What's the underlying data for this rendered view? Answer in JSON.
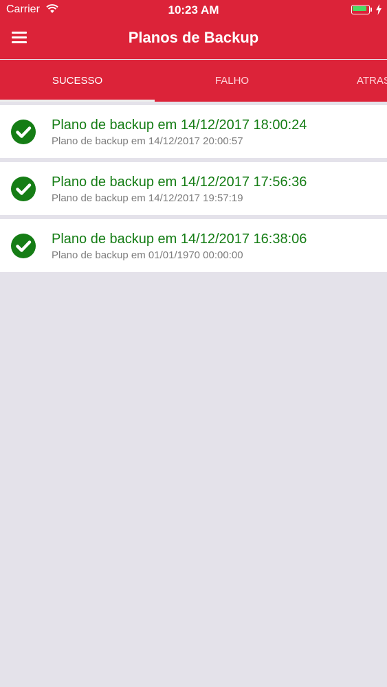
{
  "status_bar": {
    "carrier": "Carrier",
    "time": "10:23 AM",
    "battery_color": "#4cd964"
  },
  "nav": {
    "title": "Planos de Backup",
    "menu_icon": "hamburger-menu-icon"
  },
  "tabs": [
    {
      "label": "SUCESSO",
      "active": true
    },
    {
      "label": "FALHO",
      "active": false
    },
    {
      "label": "ATRASADO",
      "active": false
    }
  ],
  "colors": {
    "header": "#dc2339",
    "success_text": "#157d15",
    "check_icon": "#157d15",
    "subtitle_text": "#7d7d7d",
    "background": "#e4e2ea"
  },
  "backups": [
    {
      "title": "Plano de backup em 14/12/2017 18:00:24",
      "subtitle": "Plano de backup em 14/12/2017 20:00:57",
      "icon": "check-circle-icon"
    },
    {
      "title": "Plano de backup em 14/12/2017 17:56:36",
      "subtitle": "Plano de backup em 14/12/2017 19:57:19",
      "icon": "check-circle-icon"
    },
    {
      "title": "Plano de backup em 14/12/2017 16:38:06",
      "subtitle": "Plano de backup em 01/01/1970 00:00:00",
      "icon": "check-circle-icon"
    }
  ]
}
